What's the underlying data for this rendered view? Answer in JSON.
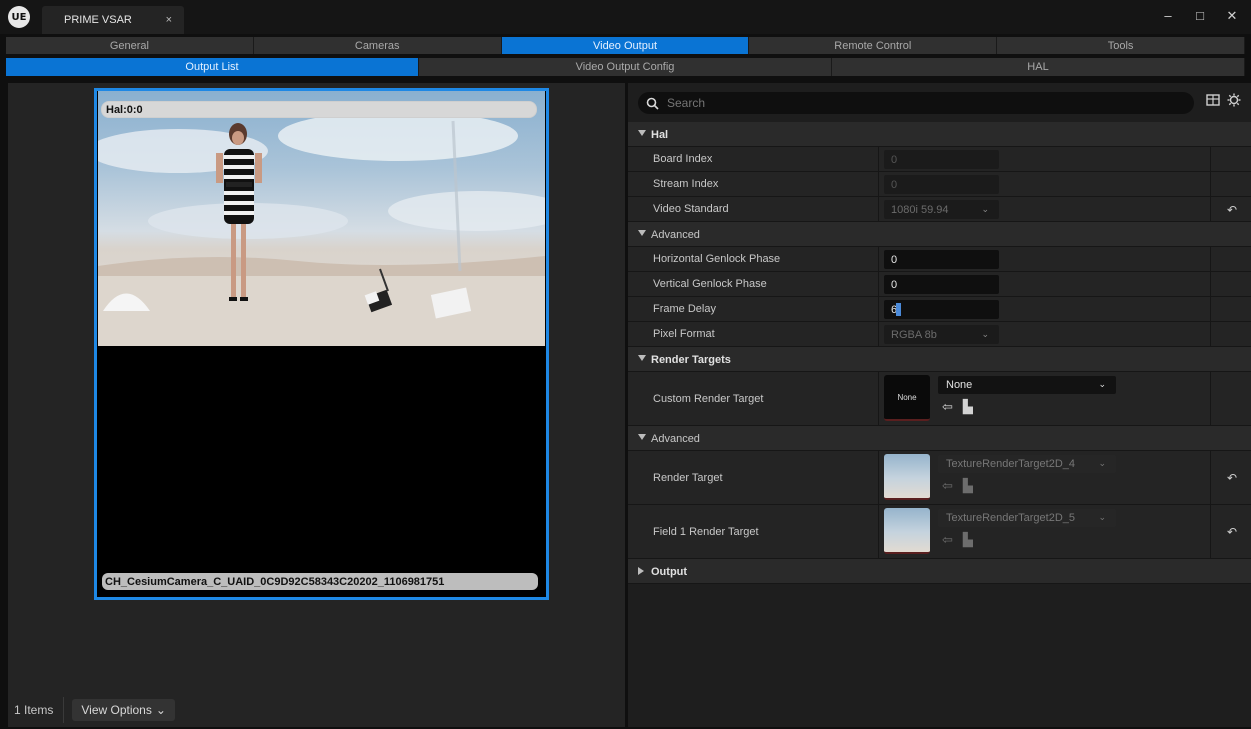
{
  "window": {
    "tab_title": "PRIME VSAR",
    "tab_close": "×",
    "minimize": "–",
    "maximize": "□",
    "close": "✕",
    "logo_text": "UE"
  },
  "main_tabs": [
    {
      "label": "General",
      "active": false
    },
    {
      "label": "Cameras",
      "active": false
    },
    {
      "label": "Video Output",
      "active": true
    },
    {
      "label": "Remote Control",
      "active": false
    },
    {
      "label": "Tools",
      "active": false
    }
  ],
  "sub_tabs": [
    {
      "label": "Output List",
      "active": true
    },
    {
      "label": "Video Output Config",
      "active": false
    },
    {
      "label": "HAL",
      "active": false
    }
  ],
  "output_tile": {
    "header": "Hal:0:0",
    "footer": "CH_CesiumCamera_C_UAID_0C9D92C58343C20202_1106981751"
  },
  "status_bar": {
    "items_count": "1 Items",
    "view_options": "View Options",
    "view_options_chevron": "⌄"
  },
  "details": {
    "search_placeholder": "Search",
    "search_icon": "search-icon",
    "hal_category": "Hal",
    "board_index": {
      "label": "Board Index",
      "value": "0"
    },
    "stream_index": {
      "label": "Stream Index",
      "value": "0"
    },
    "video_standard": {
      "label": "Video Standard",
      "value": "1080i 59.94"
    },
    "advanced_category_1": "Advanced",
    "h_genlock": {
      "label": "Horizontal Genlock Phase",
      "value": "0"
    },
    "v_genlock": {
      "label": "Vertical Genlock Phase",
      "value": "0"
    },
    "frame_delay": {
      "label": "Frame Delay",
      "value": "6"
    },
    "pixel_format": {
      "label": "Pixel Format",
      "value": "RGBA 8b"
    },
    "render_targets_category": "Render Targets",
    "custom_render_target": {
      "label": "Custom Render Target",
      "thumb_text": "None",
      "value": "None"
    },
    "advanced_category_2": "Advanced",
    "render_target": {
      "label": "Render Target",
      "value": "TextureRenderTarget2D_4"
    },
    "field1_render_target": {
      "label": "Field 1 Render Target",
      "value": "TextureRenderTarget2D_5"
    },
    "output_category": "Output",
    "reset_glyph": "↶",
    "dropdown_chevron": "⌄",
    "browse_glyph": "⇦",
    "folder_glyph": "▙"
  },
  "colors": {
    "accent": "#0a74d4",
    "selection_border": "#1e88e5"
  }
}
